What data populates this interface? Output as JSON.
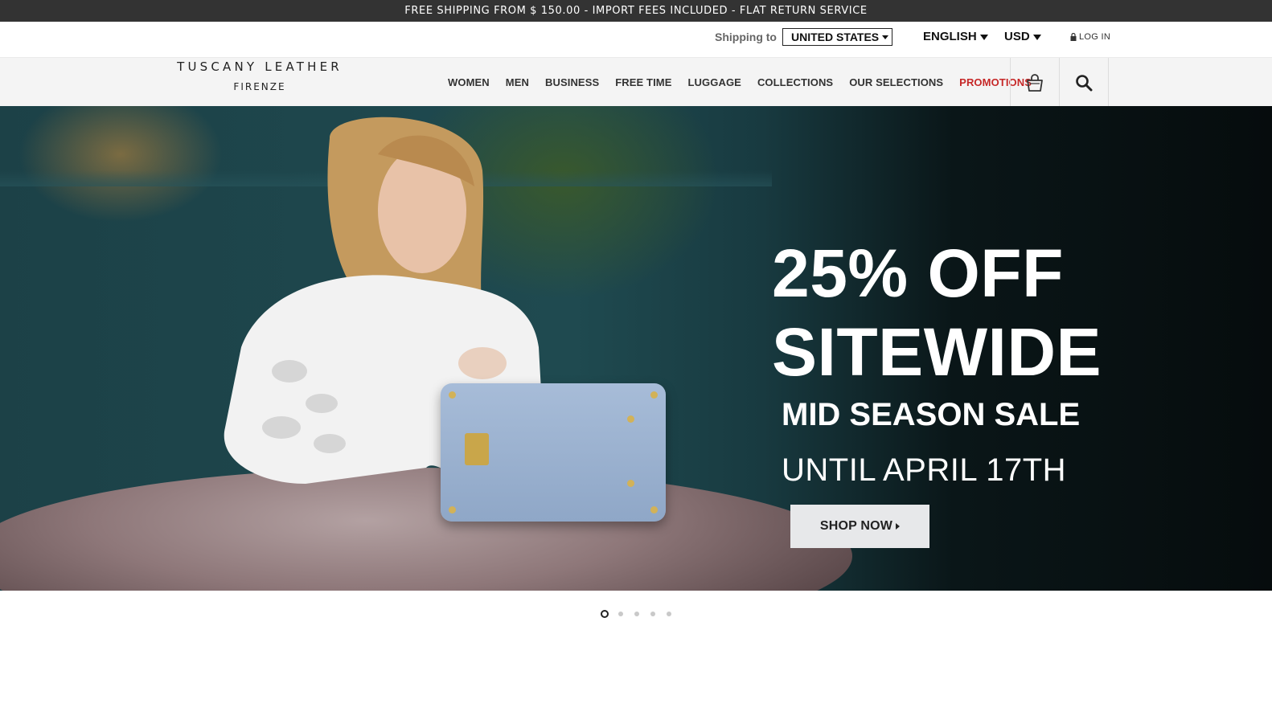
{
  "promo_bar": {
    "text": "FREE SHIPPING FROM $ 150.00 - IMPORT FEES INCLUDED - FLAT RETURN SERVICE"
  },
  "utility": {
    "shipping_label": "Shipping to",
    "country": "UNITED STATES",
    "language": "ENGLISH",
    "currency": "USD",
    "login": "LOG IN"
  },
  "logo": {
    "main": "TUSCANY LEATHER",
    "sub": "FIRENZE"
  },
  "nav": {
    "items": [
      "WOMEN",
      "MEN",
      "BUSINESS",
      "FREE TIME",
      "LUGGAGE",
      "COLLECTIONS",
      "OUR SELECTIONS",
      "PROMOTIONS"
    ],
    "promo_color": "#c62828",
    "icons": [
      "bag-icon",
      "search-icon"
    ]
  },
  "hero": {
    "headline_1": "25% OFF",
    "headline_2": "SITEWIDE",
    "subheadline": "MID SEASON SALE",
    "date_line": "UNTIL APRIL 17TH",
    "cta": "SHOP NOW"
  },
  "carousel": {
    "total": 5,
    "active": 1
  },
  "colors": {
    "promo_bar": "#333333",
    "nav_bg": "#f4f4f4",
    "cta_bg": "#e7e8ea"
  }
}
